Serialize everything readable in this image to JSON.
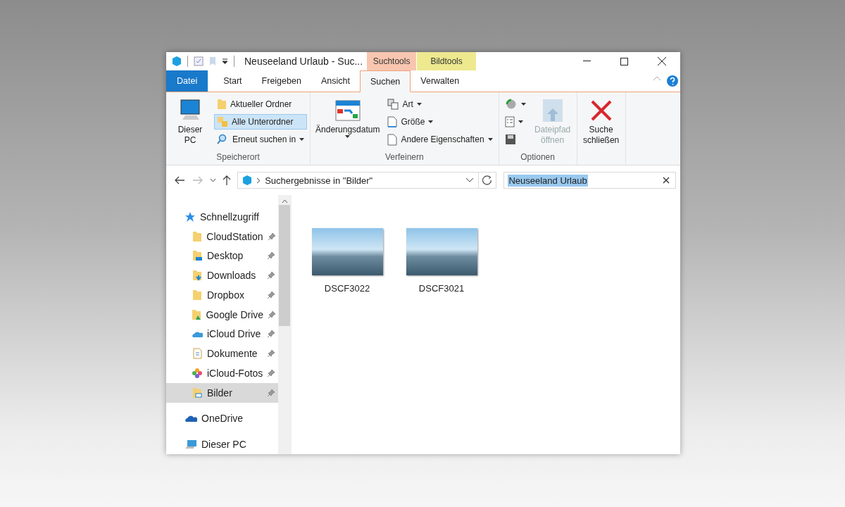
{
  "window": {
    "title": "Neuseeland Urlaub - Suc..."
  },
  "contextual_tabs": [
    {
      "label": "Suchtools",
      "color": "#f8c6b0"
    },
    {
      "label": "Bildtools",
      "color": "#eee98f"
    }
  ],
  "tabs": [
    {
      "label": "Datei",
      "kind": "file",
      "selected": false
    },
    {
      "label": "Start",
      "kind": "tab",
      "selected": false
    },
    {
      "label": "Freigeben",
      "kind": "tab",
      "selected": false
    },
    {
      "label": "Ansicht",
      "kind": "tab",
      "selected": false
    },
    {
      "label": "Suchen",
      "kind": "tab",
      "selected": true
    },
    {
      "label": "Verwalten",
      "kind": "tab",
      "selected": false
    }
  ],
  "ribbon": {
    "groups": [
      {
        "label": "Speicherort",
        "items": [
          {
            "kind": "large",
            "label": "Dieser PC",
            "dropdown": false,
            "disabled": false
          },
          {
            "kind": "small",
            "label": "Aktueller Ordner",
            "dropdown": false,
            "selected": false
          },
          {
            "kind": "small",
            "label": "Alle Unterordner",
            "dropdown": false,
            "selected": true
          },
          {
            "kind": "small",
            "label": "Erneut suchen in",
            "dropdown": true,
            "selected": false
          }
        ]
      },
      {
        "label": "Verfeinern",
        "items": [
          {
            "kind": "large",
            "label": "Änderungsdatum",
            "dropdown": true,
            "disabled": false
          },
          {
            "kind": "small",
            "label": "Art",
            "dropdown": true,
            "selected": false
          },
          {
            "kind": "small",
            "label": "Größe",
            "dropdown": true,
            "selected": false
          },
          {
            "kind": "small",
            "label": "Andere Eigenschaften",
            "dropdown": true,
            "selected": false
          }
        ]
      },
      {
        "label": "Optionen",
        "items": [
          {
            "kind": "iconsmall",
            "dropdown": true
          },
          {
            "kind": "iconsmall",
            "dropdown": true
          },
          {
            "kind": "iconsmall",
            "dropdown": false
          },
          {
            "kind": "large",
            "label": "Dateipfad öffnen",
            "dropdown": false,
            "disabled": true
          }
        ]
      },
      {
        "items": [
          {
            "kind": "large",
            "label": "Suche schließen",
            "dropdown": false,
            "disabled": false
          }
        ]
      }
    ]
  },
  "address": {
    "path": "Suchergebnisse in \"Bilder\""
  },
  "search": {
    "value": "Neuseeland Urlaub"
  },
  "nav": [
    {
      "label": "Schnellzugriff",
      "selected": false,
      "children": [
        {
          "label": "CloudStation",
          "pinned": true,
          "selected": false
        },
        {
          "label": "Desktop",
          "pinned": true,
          "selected": false
        },
        {
          "label": "Downloads",
          "pinned": true,
          "selected": false
        },
        {
          "label": "Dropbox",
          "pinned": true,
          "selected": false
        },
        {
          "label": "Google Drive",
          "pinned": true,
          "selected": false
        },
        {
          "label": "iCloud Drive",
          "pinned": true,
          "selected": false
        },
        {
          "label": "Dokumente",
          "pinned": true,
          "selected": false
        },
        {
          "label": "iCloud-Fotos",
          "pinned": true,
          "selected": false
        },
        {
          "label": "Bilder",
          "pinned": true,
          "selected": true
        }
      ]
    },
    {
      "label": "OneDrive",
      "selected": false
    },
    {
      "label": "Dieser PC",
      "selected": false
    }
  ],
  "files": [
    {
      "name": "DSCF3022"
    },
    {
      "name": "DSCF3021"
    }
  ]
}
